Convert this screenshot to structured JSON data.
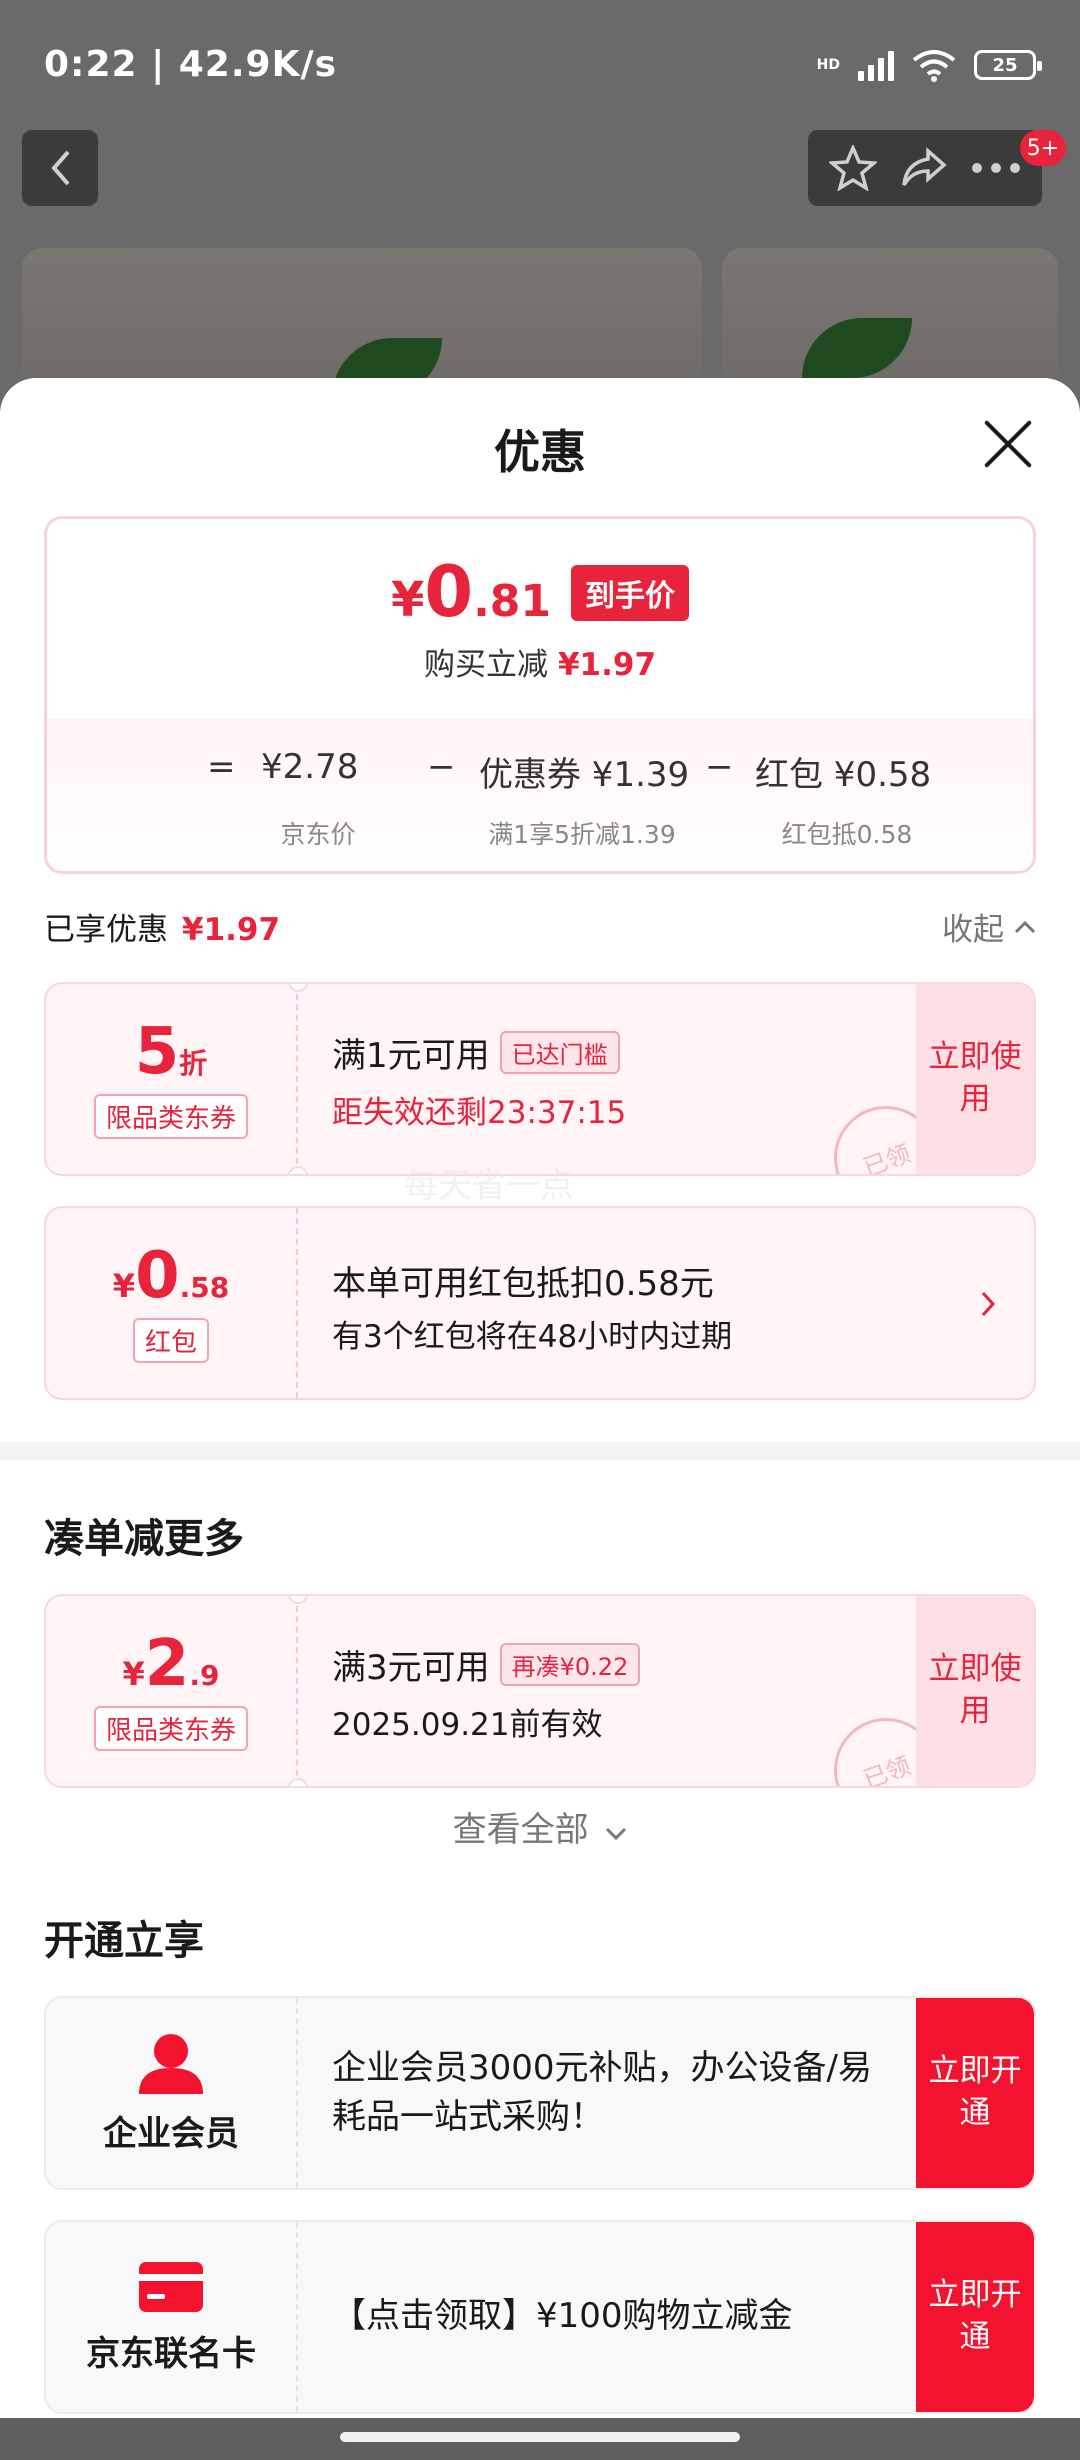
{
  "status_bar": {
    "time_speed": "0:22 | 42.9K/s",
    "network": "HD",
    "battery": "25"
  },
  "nav": {
    "badge": "5+"
  },
  "sheet": {
    "title": "优惠"
  },
  "price_card": {
    "yen": "¥",
    "int": "0",
    "dec": ".81",
    "tag": "到手价",
    "sub_label": "购买立减",
    "sub_value": "¥1.97",
    "breakdown": {
      "eq": "=",
      "jd_price": "¥2.78",
      "jd_caption": "京东价",
      "minus1": "−",
      "coupon": "优惠券 ¥1.39",
      "coupon_caption": "满1享5折减1.39",
      "minus2": "−",
      "redpacket": "红包 ¥0.58",
      "redpacket_caption": "红包抵0.58"
    }
  },
  "enjoyed": {
    "label": "已享优惠",
    "value": "¥1.97",
    "collapse": "收起"
  },
  "coupons_applied": [
    {
      "amount_big": "5",
      "amount_small": "折",
      "tag": "限品类东券",
      "title": "满1元可用",
      "badge": "已达门槛",
      "line2": "距失效还剩23:37:15",
      "action": "立即使用",
      "stamp": "已领"
    },
    {
      "amount_yen": "¥",
      "amount_big": "0",
      "amount_small": ".58",
      "tag": "红包",
      "title": "本单可用红包抵扣0.58元",
      "line2": "有3个红包将在48小时内过期"
    }
  ],
  "watermark": "每天省一点",
  "more_section": {
    "title": "凑单减更多",
    "coupon": {
      "amount_yen": "¥",
      "amount_big": "2",
      "amount_small": ".9",
      "tag": "限品类东券",
      "title": "满3元可用",
      "badge": "再凑¥0.22",
      "line2": "2025.09.21前有效",
      "action": "立即使用",
      "stamp": "已领"
    },
    "view_all": "查看全部"
  },
  "open_section": {
    "title": "开通立享",
    "items": [
      {
        "label": "企业会员",
        "desc": " 企业会员3000元补贴，办公设备/易耗品一站式采购！",
        "action": "立即开通"
      },
      {
        "label": "京东联名卡",
        "desc": "【点击领取】¥100购物立减金",
        "action": "立即开通"
      }
    ]
  },
  "colors": {
    "accent": "#e8233c",
    "open_button": "#f3132f",
    "coupon_bg": "#fff4f6"
  }
}
